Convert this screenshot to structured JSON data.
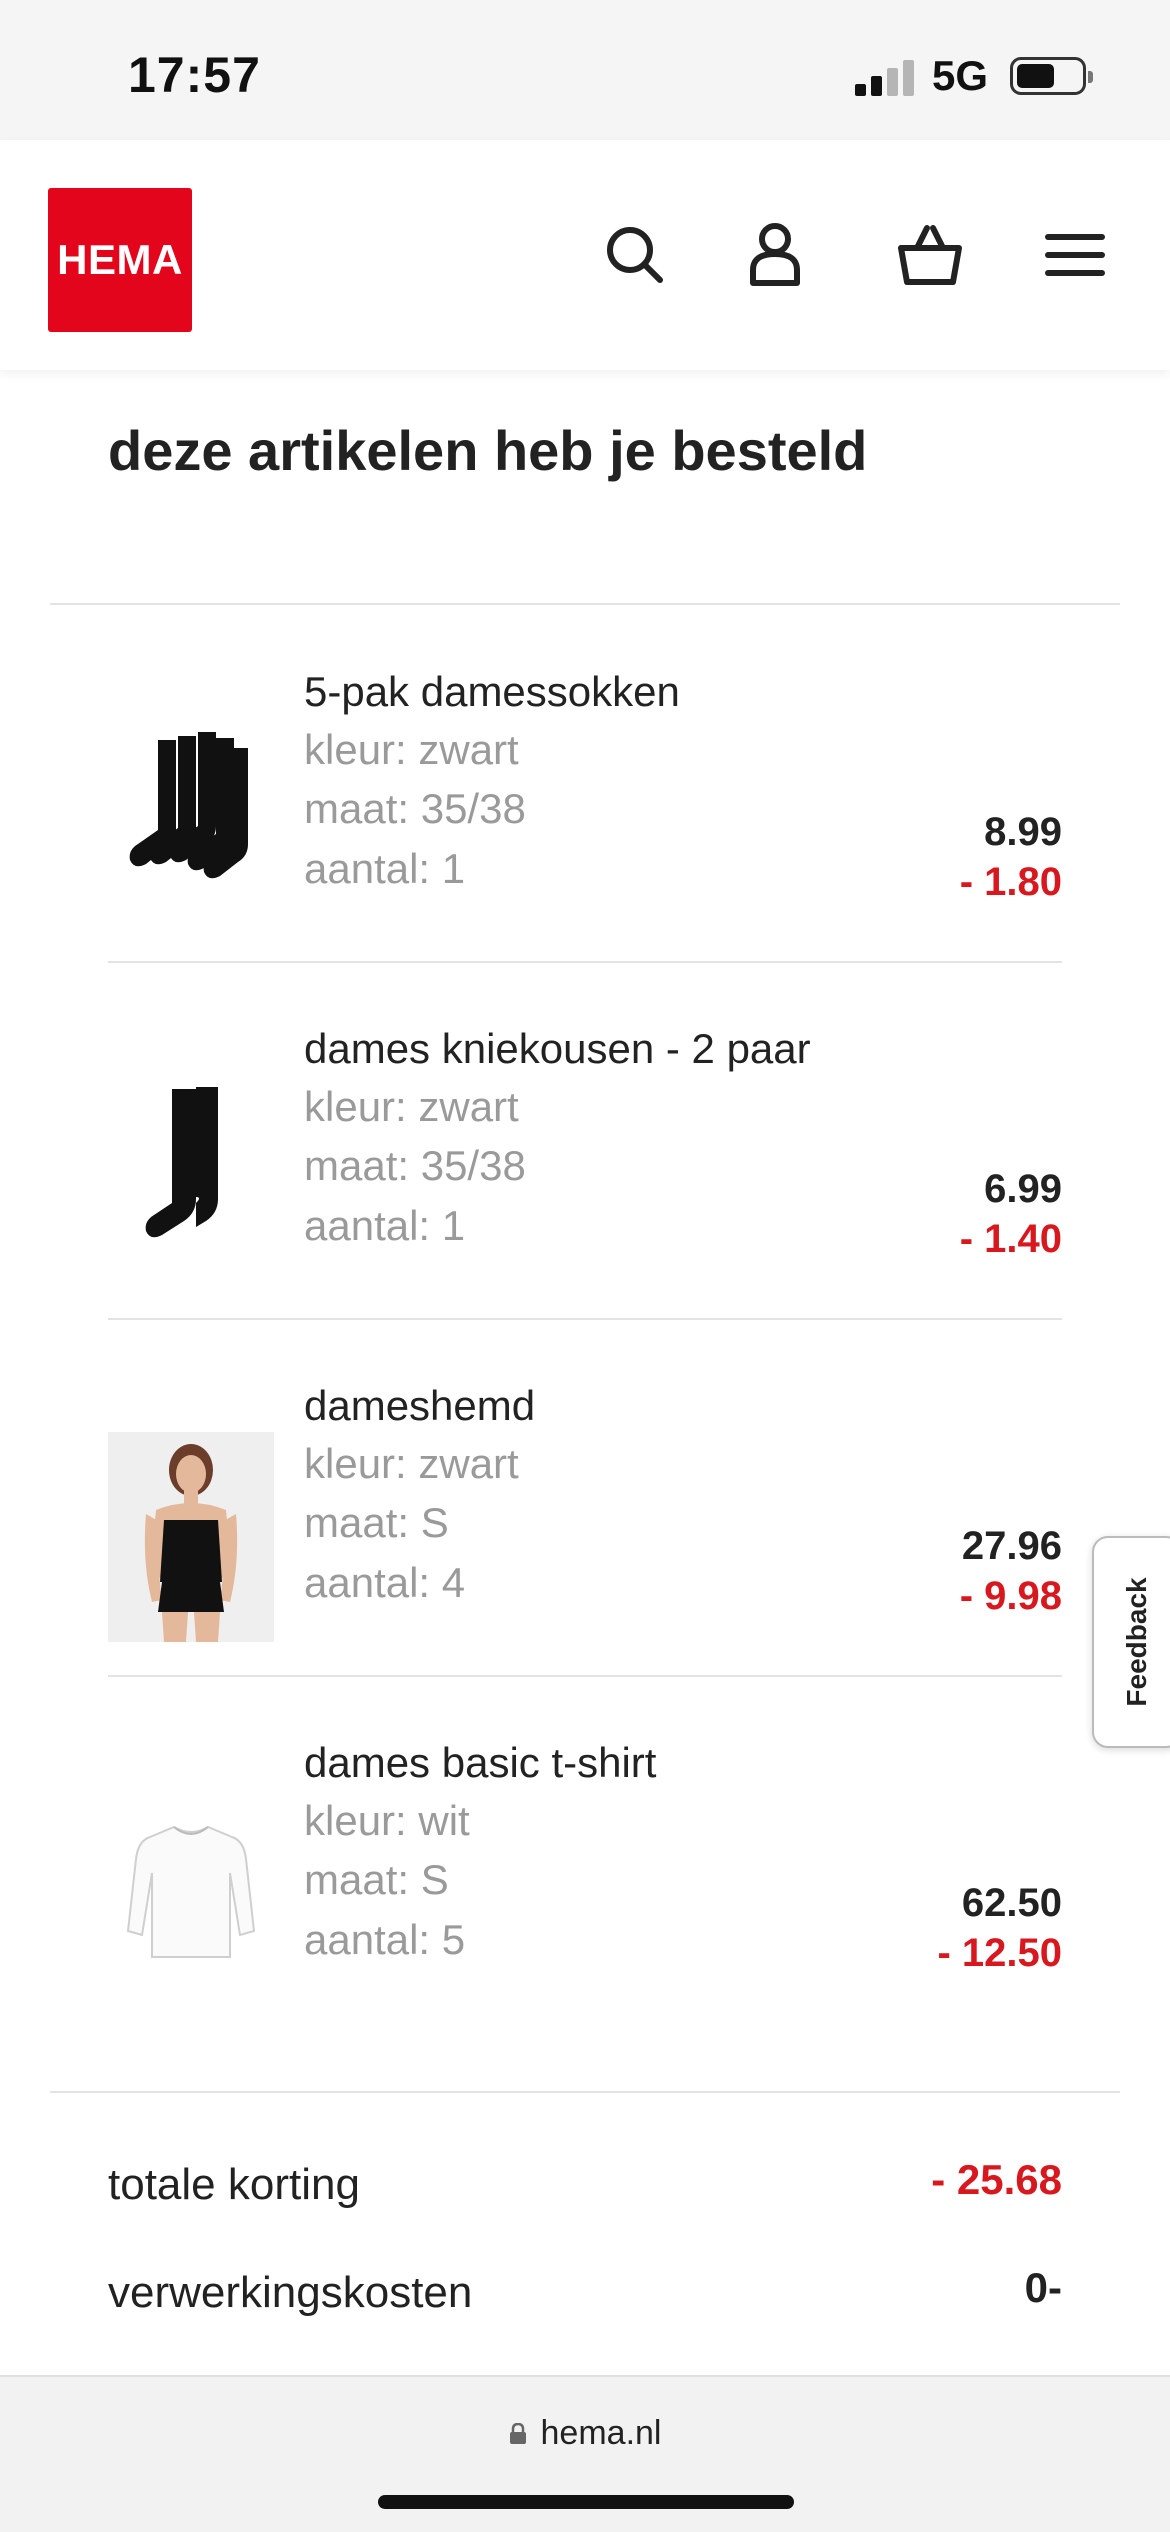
{
  "status_bar": {
    "time": "17:57",
    "network": "5G"
  },
  "header": {
    "logo_text": "HEMA"
  },
  "title": "deze artikelen heb je besteld",
  "items": [
    {
      "name": "5-pak damessokken",
      "color": "kleur: zwart",
      "size": "maat: 35/38",
      "quantity": "aantal: 1",
      "price": "8.99",
      "discount": "- 1.80"
    },
    {
      "name": "dames kniekousen - 2 paar",
      "color": "kleur: zwart",
      "size": "maat: 35/38",
      "quantity": "aantal: 1",
      "price": "6.99",
      "discount": "- 1.40"
    },
    {
      "name": "dameshemd",
      "color": "kleur: zwart",
      "size": "maat: S",
      "quantity": "aantal: 4",
      "price": "27.96",
      "discount": "- 9.98"
    },
    {
      "name": "dames basic t-shirt",
      "color": "kleur: wit",
      "size": "maat: S",
      "quantity": "aantal: 5",
      "price": "62.50",
      "discount": "- 12.50"
    }
  ],
  "summary": {
    "total_discount_label": "totale korting",
    "total_discount_value": "- 25.68",
    "processing_label": "verwerkingskosten",
    "processing_value": "0-"
  },
  "feedback_label": "Feedback",
  "browser": {
    "url": "hema.nl"
  },
  "colors": {
    "brand": "#e3051b",
    "discount": "#d7191f"
  }
}
